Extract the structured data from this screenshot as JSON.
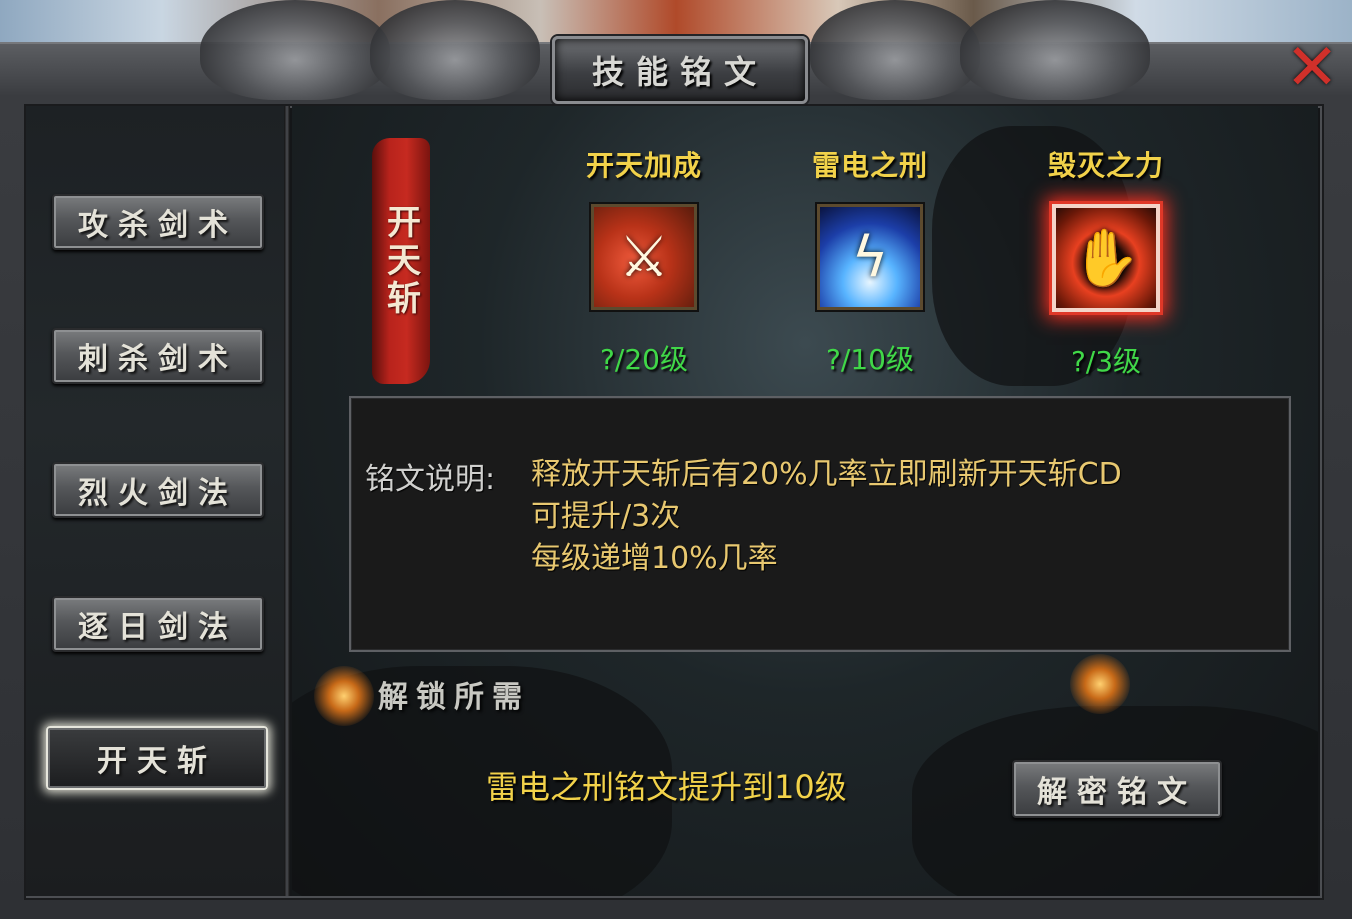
{
  "window": {
    "title": "技能铭文",
    "close_icon": "close-x-icon"
  },
  "sidebar": {
    "items": [
      {
        "label": "攻杀剑术",
        "active": false
      },
      {
        "label": "刺杀剑术",
        "active": false
      },
      {
        "label": "烈火剑法",
        "active": false
      },
      {
        "label": "逐日剑法",
        "active": false
      },
      {
        "label": "开天斩",
        "active": true
      }
    ]
  },
  "skill_banner": "开天斩",
  "inscriptions": [
    {
      "name": "开天加成",
      "level": "?/20级",
      "icon": "red-sword-icon",
      "selected": false
    },
    {
      "name": "雷电之刑",
      "level": "?/10级",
      "icon": "lightning-icon",
      "selected": false
    },
    {
      "name": "毁灭之力",
      "level": "?/3级",
      "icon": "flaming-hand-icon",
      "selected": true
    }
  ],
  "description": {
    "label": "铭文说明:",
    "lines": [
      "释放开天斩后有20%几率立即刷新开天斩CD",
      "可提升/3次",
      "每级递增10%几率"
    ]
  },
  "unlock": {
    "title": "解锁所需",
    "requirement": "雷电之刑铭文提升到10级"
  },
  "actions": {
    "decode_label": "解密铭文"
  },
  "colors": {
    "gold_text": "#f2d24a",
    "level_green": "#40d848",
    "desc_text": "#e8c870",
    "selected_glow": "#ff3020"
  }
}
